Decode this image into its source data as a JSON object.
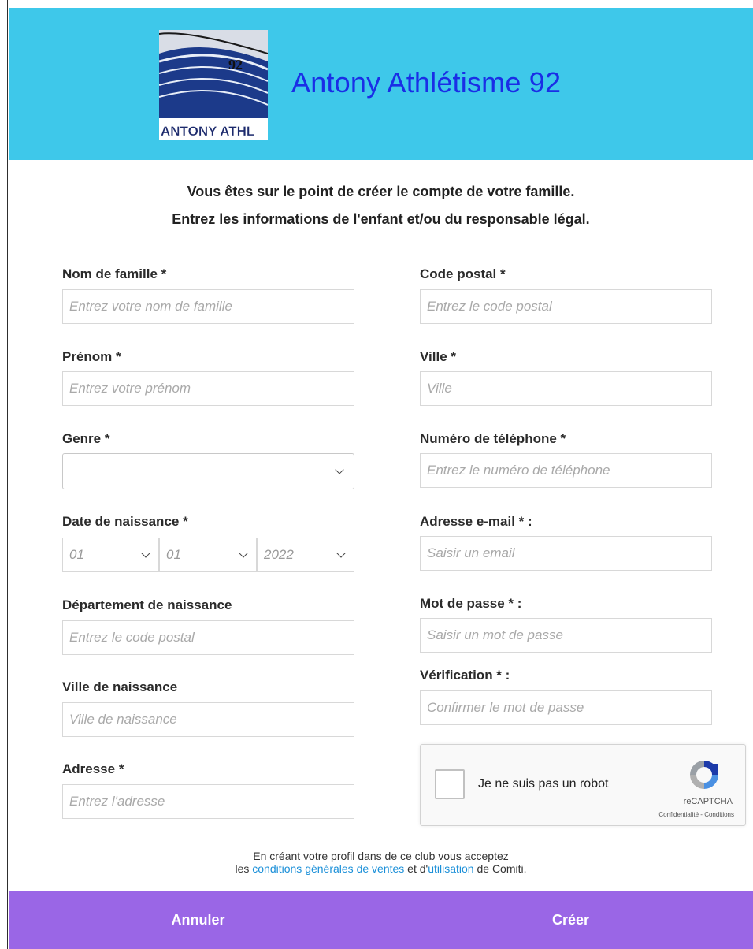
{
  "header": {
    "logo_alt": "Antony Athlétisme 92 logo",
    "logo_number": "92",
    "logo_banner": "ANTONY ATHL",
    "title": "Antony Athlétisme 92",
    "bg_color": "#3ec8ea",
    "title_color": "#1a2ee6"
  },
  "intro": {
    "line1": "Vous êtes sur le point de créer le compte de votre famille.",
    "line2": "Entrez les informations de l'enfant et/ou du responsable légal."
  },
  "form_left": {
    "nom_label": "Nom de famille *",
    "nom_placeholder": "Entrez votre nom de famille",
    "prenom_label": "Prénom *",
    "prenom_placeholder": "Entrez votre prénom",
    "genre_label": "Genre *",
    "genre_value": "",
    "date_label": "Date de naissance *",
    "date_day": "01",
    "date_month": "01",
    "date_year": "2022",
    "dept_label": "Département de naissance",
    "dept_placeholder": "Entrez le code postal",
    "ville_naissance_label": "Ville de naissance",
    "ville_naissance_placeholder": "Ville de naissance",
    "adresse_label": "Adresse *",
    "adresse_placeholder": "Entrez l'adresse"
  },
  "form_right": {
    "cp_label": "Code postal *",
    "cp_placeholder": "Entrez le code postal",
    "ville_label": "Ville *",
    "ville_placeholder": "Ville",
    "tel_label": "Numéro de téléphone *",
    "tel_placeholder": "Entrez le numéro de téléphone",
    "email_label": "Adresse e-mail * :",
    "email_placeholder": "Saisir un email",
    "password_label": "Mot de passe * :",
    "password_placeholder": "Saisir un mot de passe",
    "verif_label": "Vérification * :",
    "verif_placeholder": "Confirmer le mot de passe"
  },
  "recaptcha": {
    "text": "Je ne suis pas un robot",
    "brand": "reCAPTCHA",
    "privacy": "Confidentialité",
    "separator": " - ",
    "terms": "Conditions"
  },
  "legal": {
    "line1": "En créant votre profil dans de ce club vous acceptez",
    "prefix": "les ",
    "cgv_link": "conditions générales de ventes",
    "middle": " et d'",
    "usage_link": "utilisation",
    "suffix": " de Comiti."
  },
  "footer": {
    "cancel_label": "Annuler",
    "create_label": "Créer",
    "bg_color": "#9a66e6"
  }
}
